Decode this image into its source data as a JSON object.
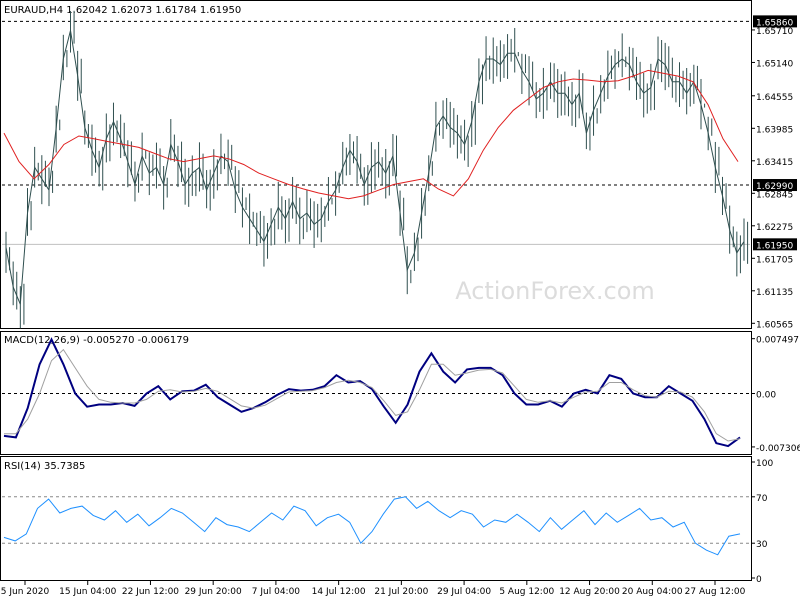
{
  "chart_data": [
    {
      "type": "line",
      "panel": "price",
      "title": "EURAUD,H4  1.62042 1.62073 1.61784 1.61950",
      "watermark": "ActionForex.com",
      "ylim": [
        1.605,
        1.662
      ],
      "yticks": [
        "1.65710",
        "1.65140",
        "1.64555",
        "1.63985",
        "1.63415",
        "1.62845",
        "1.62275",
        "1.61705",
        "1.61135",
        "1.60565"
      ],
      "yticks_values": [
        1.6571,
        1.6514,
        1.64555,
        1.63985,
        1.63415,
        1.62845,
        1.62275,
        1.61705,
        1.61135,
        1.60565
      ],
      "levels": [
        {
          "label": "1.65860",
          "value": 1.6586,
          "style": "dashed"
        },
        {
          "label": "1.62990",
          "value": 1.6299,
          "style": "dashed"
        },
        {
          "label": "1.61950",
          "value": 1.6195,
          "style": "solid"
        }
      ],
      "series": [
        {
          "name": "",
          "kind": "price",
          "color": "#2f4f4f",
          "values": [
            1.619,
            1.612,
            1.609,
            1.625,
            1.633,
            1.631,
            1.629,
            1.64,
            1.652,
            1.657,
            1.649,
            1.64,
            1.636,
            1.633,
            1.638,
            1.641,
            1.638,
            1.634,
            1.63,
            1.635,
            1.632,
            1.633,
            1.63,
            1.637,
            1.634,
            1.63,
            1.632,
            1.633,
            1.629,
            1.632,
            1.635,
            1.634,
            1.629,
            1.626,
            1.624,
            1.622,
            1.62,
            1.623,
            1.626,
            1.624,
            1.627,
            1.624,
            1.625,
            1.623,
            1.624,
            1.627,
            1.629,
            1.633,
            1.636,
            1.634,
            1.63,
            1.633,
            1.634,
            1.632,
            1.635,
            1.625,
            1.615,
            1.618,
            1.625,
            1.632,
            1.64,
            1.642,
            1.64,
            1.639,
            1.637,
            1.641,
            1.648,
            1.652,
            1.652,
            1.651,
            1.653,
            1.653,
            1.65,
            1.648,
            1.645,
            1.646,
            1.648,
            1.646,
            1.646,
            1.644,
            1.646,
            1.639,
            1.643,
            1.646,
            1.649,
            1.651,
            1.652,
            1.651,
            1.648,
            1.646,
            1.647,
            1.652,
            1.651,
            1.648,
            1.648,
            1.646,
            1.648,
            1.644,
            1.639,
            1.633,
            1.628,
            1.622,
            1.618,
            1.62
          ]
        },
        {
          "name": "",
          "kind": "ma",
          "color": "#e02020",
          "values": [
            1.639,
            1.634,
            1.631,
            1.6335,
            1.637,
            1.6385,
            1.638,
            1.6375,
            1.637,
            1.6365,
            1.6355,
            1.6345,
            1.634,
            1.6345,
            1.635,
            1.6345,
            1.6335,
            1.632,
            1.631,
            1.63,
            1.6292,
            1.6285,
            1.628,
            1.6275,
            1.628,
            1.629,
            1.63,
            1.6305,
            1.631,
            1.6292,
            1.628,
            1.631,
            1.636,
            1.64,
            1.643,
            1.645,
            1.647,
            1.648,
            1.6485,
            1.6483,
            1.648,
            1.6482,
            1.649,
            1.65,
            1.6495,
            1.649,
            1.648,
            1.644,
            1.638,
            1.634
          ]
        }
      ]
    },
    {
      "type": "line",
      "panel": "macd",
      "title": "MACD(12,26,9) -0.005270 -0.006179",
      "ylim": [
        -0.008,
        0.008
      ],
      "yticks": [
        "0.007497",
        "0.00",
        "-0.007306"
      ],
      "yticks_values": [
        0.007497,
        0.0,
        -0.007306
      ],
      "series": [
        {
          "name": "",
          "kind": "macd",
          "color": "#000080",
          "values": [
            -0.0058,
            -0.006,
            -0.002,
            0.004,
            0.0074,
            0.004,
            0.0,
            -0.0018,
            -0.0015,
            -0.0015,
            -0.0013,
            -0.0017,
            0.0,
            0.001,
            -0.0008,
            0.0003,
            0.0004,
            0.0012,
            -0.0005,
            -0.0015,
            -0.0025,
            -0.002,
            -0.0012,
            -0.0002,
            0.0006,
            0.0004,
            0.0005,
            0.001,
            0.0025,
            0.0015,
            0.0017,
            0.0006,
            -0.0018,
            -0.004,
            -0.0015,
            0.003,
            0.0055,
            0.003,
            0.0015,
            0.0033,
            0.0035,
            0.0035,
            0.0025,
            0.0,
            -0.0015,
            -0.0015,
            -0.001,
            -0.0018,
            0.0,
            0.0005,
            0.0,
            0.0025,
            0.002,
            0.0,
            -0.0005,
            -0.0005,
            0.001,
            0.0,
            -0.001,
            -0.0035,
            -0.0068,
            -0.0072,
            -0.006
          ]
        },
        {
          "name": "",
          "kind": "signal",
          "color": "#a0a0a0",
          "values": [
            -0.0055,
            -0.0055,
            -0.0035,
            0.0,
            0.0045,
            0.006,
            0.0035,
            0.001,
            -0.0008,
            -0.0012,
            -0.0013,
            -0.0013,
            -0.0008,
            0.0003,
            0.0005,
            0.0002,
            0.0003,
            0.0007,
            0.0003,
            -0.0007,
            -0.0017,
            -0.002,
            -0.0016,
            -0.0007,
            0.0002,
            0.0003,
            0.0004,
            0.0008,
            0.0015,
            0.0018,
            0.0015,
            0.0008,
            -0.001,
            -0.003,
            -0.0025,
            0.0005,
            0.004,
            0.004,
            0.0025,
            0.0028,
            0.0032,
            0.0033,
            0.0028,
            0.001,
            -0.0008,
            -0.0012,
            -0.001,
            -0.0013,
            -0.0005,
            0.0002,
            0.0003,
            0.0015,
            0.0015,
            0.0005,
            -0.0003,
            -0.0005,
            0.0003,
            0.0002,
            -0.0005,
            -0.0025,
            -0.0055,
            -0.0065,
            -0.0062
          ]
        }
      ]
    },
    {
      "type": "line",
      "panel": "rsi",
      "title": "RSI(14) 35.7385",
      "ylim": [
        0,
        100
      ],
      "yticks": [
        "100",
        "70",
        "30",
        "0"
      ],
      "yticks_values": [
        100,
        70,
        30,
        0
      ],
      "levels": [
        {
          "label": "70",
          "value": 70,
          "style": "dashed"
        },
        {
          "label": "30",
          "value": 30,
          "style": "dashed"
        }
      ],
      "series": [
        {
          "name": "",
          "kind": "rsi",
          "color": "#1e90ff",
          "values": [
            35,
            32,
            38,
            60,
            68,
            56,
            60,
            62,
            54,
            50,
            58,
            48,
            55,
            45,
            52,
            60,
            56,
            48,
            40,
            52,
            46,
            44,
            40,
            48,
            56,
            50,
            62,
            58,
            45,
            52,
            55,
            48,
            30,
            40,
            55,
            68,
            70,
            60,
            66,
            58,
            52,
            58,
            55,
            44,
            50,
            48,
            55,
            48,
            40,
            52,
            42,
            50,
            58,
            46,
            56,
            48,
            54,
            60,
            50,
            52,
            44,
            48,
            30,
            24,
            20,
            36,
            38
          ]
        }
      ],
      "xtick_labels": [
        "5 Jun 2020",
        "15 Jun 04:00",
        "22 Jun 12:00",
        "29 Jun 20:00",
        "7 Jul 04:00",
        "14 Jul 12:00",
        "21 Jul 20:00",
        "29 Jul 04:00",
        "5 Aug 12:00",
        "12 Aug 20:00",
        "20 Aug 04:00",
        "27 Aug 12:00"
      ]
    }
  ]
}
